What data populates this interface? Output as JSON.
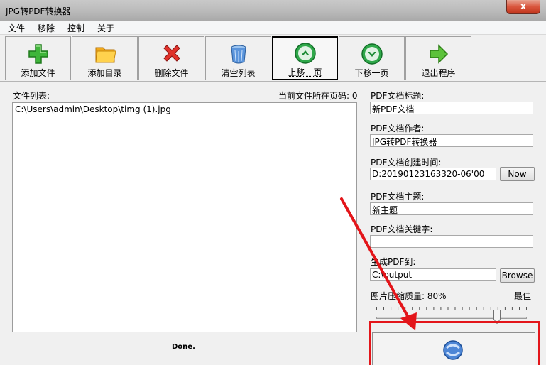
{
  "window": {
    "title": "JPG转PDF转换器",
    "close_label": "x"
  },
  "menu": {
    "items": [
      "文件",
      "移除",
      "控制",
      "关于"
    ]
  },
  "toolbar": {
    "buttons": [
      {
        "label": "添加文件"
      },
      {
        "label": "添加目录"
      },
      {
        "label": "删除文件"
      },
      {
        "label": "清空列表"
      },
      {
        "label": "上移一页"
      },
      {
        "label": "下移一页"
      },
      {
        "label": "退出程序"
      }
    ]
  },
  "file_list": {
    "label": "文件列表:",
    "page_label": "当前文件所在页码: 0",
    "items": [
      "C:\\Users\\admin\\Desktop\\timg (1).jpg"
    ]
  },
  "status": "Done.",
  "pdf": {
    "title_label": "PDF文档标题:",
    "title_value": "新PDF文档",
    "author_label": "PDF文档作者:",
    "author_value": "JPG转PDF转换器",
    "created_label": "PDF文档创建时间:",
    "created_value": "D:20190123163320-06'00",
    "now_label": "Now",
    "subject_label": "PDF文档主题:",
    "subject_value": "新主题",
    "keywords_label": "PDF文档关键字:",
    "keywords_value": "",
    "output_label": "生成PDF到:",
    "output_value": "C:\\output",
    "browse_label": "Browse",
    "quality_label": "图片压缩质量: 80%",
    "quality_best_label": "最佳",
    "quality_value": 0.8
  },
  "colors": {
    "highlight_red": "#e3151a"
  }
}
